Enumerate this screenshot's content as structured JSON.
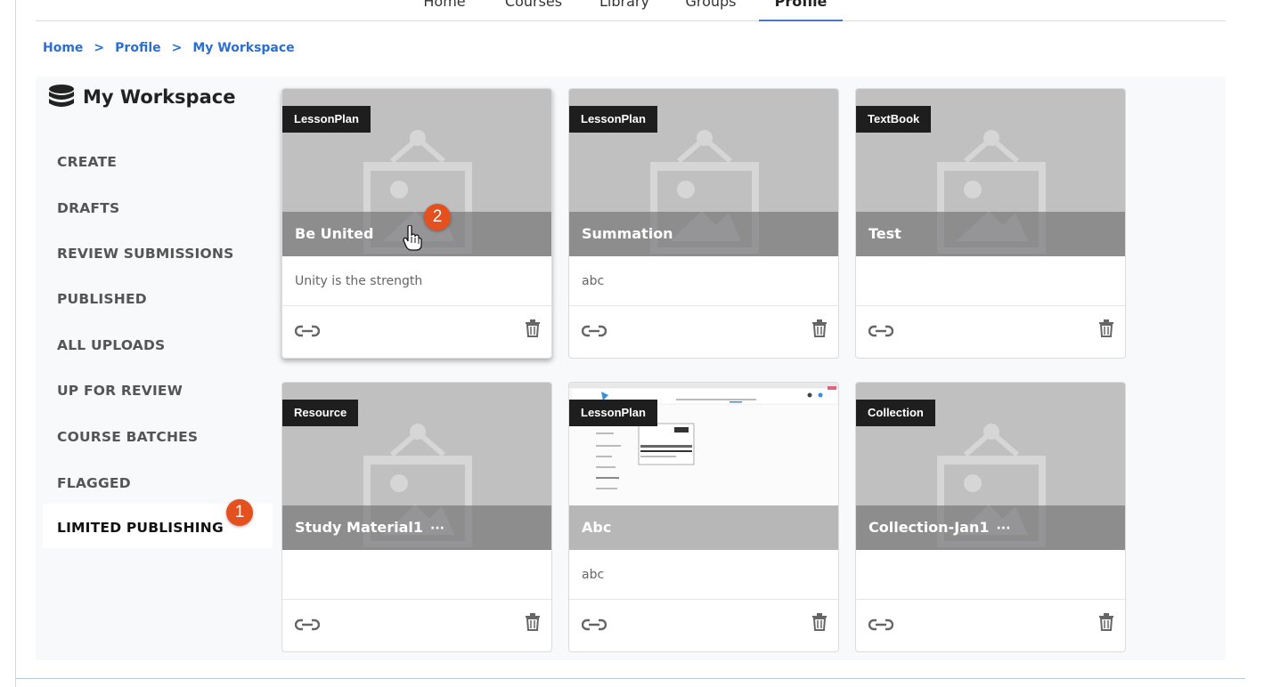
{
  "nav": {
    "items": [
      {
        "label": "Home"
      },
      {
        "label": "Courses"
      },
      {
        "label": "Library"
      },
      {
        "label": "Groups"
      },
      {
        "label": "Profile",
        "active": true
      }
    ]
  },
  "breadcrumb": [
    "Home",
    "Profile",
    "My Workspace"
  ],
  "workspace": {
    "title": "My Workspace",
    "menu": [
      "CREATE",
      "DRAFTS",
      "REVIEW SUBMISSIONS",
      "PUBLISHED",
      "ALL UPLOADS",
      "UP FOR REVIEW",
      "COURSE BATCHES",
      "FLAGGED",
      "LIMITED PUBLISHING"
    ],
    "active_item": "LIMITED PUBLISHING"
  },
  "annotations": {
    "badge1": "1",
    "badge2": "2"
  },
  "cards": [
    {
      "type": "LessonPlan",
      "title": "Be United",
      "description": "Unity is the strength",
      "more": false
    },
    {
      "type": "LessonPlan",
      "title": "Summation",
      "description": "abc",
      "more": false
    },
    {
      "type": "TextBook",
      "title": "Test",
      "description": "",
      "more": false
    },
    {
      "type": "Resource",
      "title": "Study Material1",
      "description": "",
      "more": true,
      "more_label": "···"
    },
    {
      "type": "LessonPlan",
      "title": "Abc",
      "description": "abc",
      "more": false
    },
    {
      "type": "Collection",
      "title": "Collection-Jan1",
      "description": "",
      "more": true,
      "more_label": "···"
    }
  ],
  "colors": {
    "accent": "#2c6fcf",
    "badge": "#e4511f",
    "tag": "#1e1e1e"
  }
}
